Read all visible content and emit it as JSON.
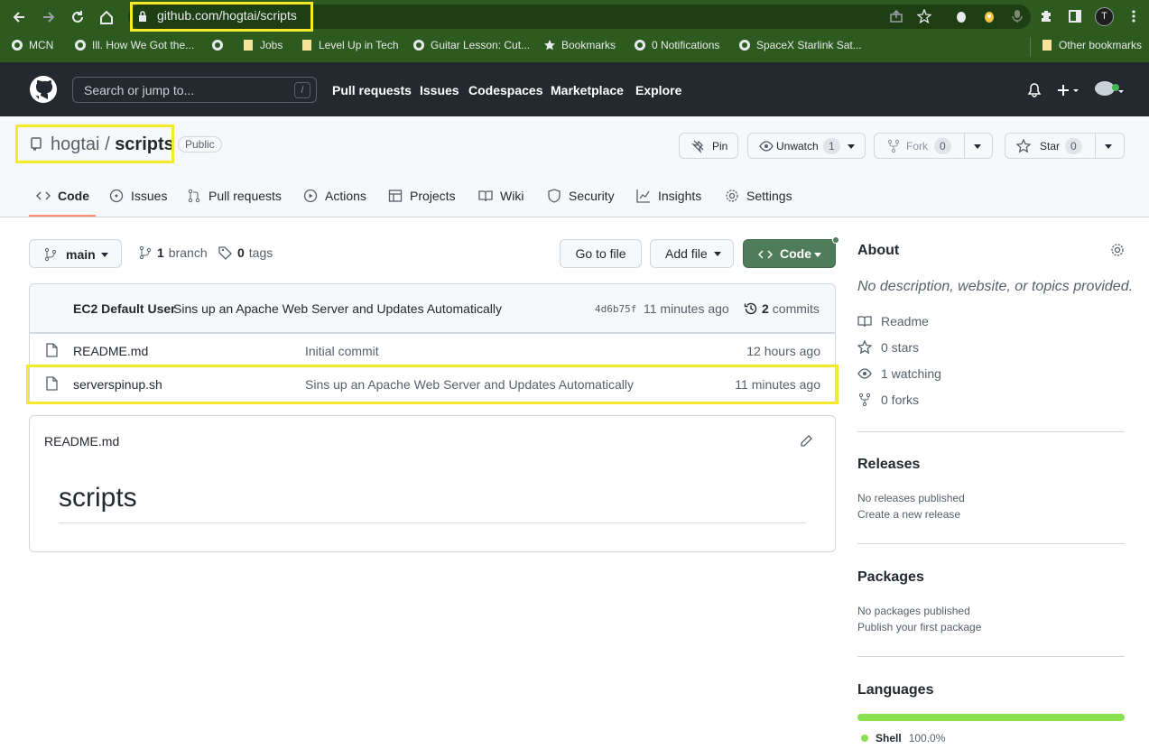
{
  "browser": {
    "url": "github.com/hogtai/scripts",
    "profile_initial": "T",
    "bookmarks": [
      "MCN",
      "Ill. How We Got the...",
      "Jobs",
      "Level Up in Tech",
      "Guitar Lesson: Cut...",
      "Bookmarks",
      "0 Notifications",
      "SpaceX Starlink Sat..."
    ],
    "other_bookmarks": "Other bookmarks"
  },
  "gh_header": {
    "search_placeholder": "Search or jump to...",
    "slash_key": "/",
    "nav": [
      "Pull requests",
      "Issues",
      "Codespaces",
      "Marketplace",
      "Explore"
    ]
  },
  "repo": {
    "owner": "hogtai",
    "separator": "/",
    "name": "scripts",
    "visibility": "Public",
    "pin_label": "Pin",
    "unwatch_label": "Unwatch",
    "unwatch_count": "1",
    "fork_label": "Fork",
    "fork_count": "0",
    "star_label": "Star",
    "star_count": "0"
  },
  "tabs": [
    "Code",
    "Issues",
    "Pull requests",
    "Actions",
    "Projects",
    "Wiki",
    "Security",
    "Insights",
    "Settings"
  ],
  "toolbar": {
    "branch": "main",
    "branch_count": "1",
    "branch_word": "branch",
    "tag_count": "0",
    "tag_word": "tags",
    "go_to_file": "Go to file",
    "add_file": "Add file",
    "code": "Code"
  },
  "commit": {
    "author": "EC2 Default User",
    "message": "Sins up an Apache Web Server and Updates Automatically",
    "sha": "4d6b75f",
    "time": "11 minutes ago",
    "commits_count": "2",
    "commits_word": "commits"
  },
  "files": [
    {
      "name": "README.md",
      "message": "Initial commit",
      "time": "12 hours ago"
    },
    {
      "name": "serverspinup.sh",
      "message": "Sins up an Apache Web Server and Updates Automatically",
      "time": "11 minutes ago"
    }
  ],
  "readme": {
    "filename": "README.md",
    "heading": "scripts"
  },
  "about": {
    "title": "About",
    "description": "No description, website, or topics provided.",
    "readme": "Readme",
    "stars": "0 stars",
    "watching": "1 watching",
    "forks": "0 forks"
  },
  "releases": {
    "title": "Releases",
    "none": "No releases published",
    "create": "Create a new release"
  },
  "packages": {
    "title": "Packages",
    "none": "No packages published",
    "publish": "Publish your first package"
  },
  "languages": {
    "title": "Languages",
    "items": [
      {
        "name": "Shell",
        "percent": "100.0%",
        "share": 100,
        "color": "#89e051"
      }
    ]
  },
  "colors": {
    "browser_green": "#2d5a1e",
    "highlight_yellow": "#f4ea2a",
    "code_button_green": "#2da44e"
  }
}
